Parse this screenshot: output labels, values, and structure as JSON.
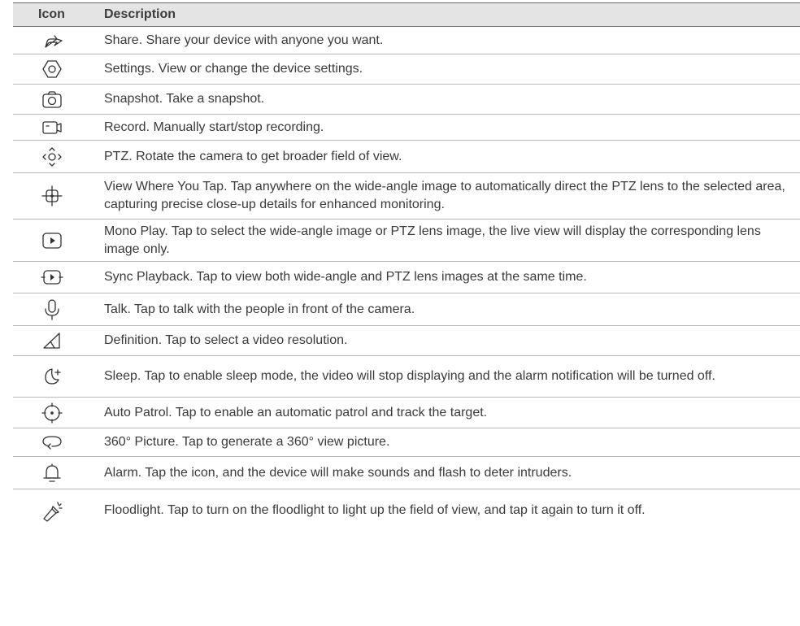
{
  "header": {
    "icon": "Icon",
    "description": "Description"
  },
  "rows": [
    {
      "icon": "share-icon",
      "text": "Share. Share your device with anyone you want."
    },
    {
      "icon": "settings-icon",
      "text": "Settings. View or change the device settings."
    },
    {
      "icon": "camera-icon",
      "text": "Snapshot. Take a snapshot."
    },
    {
      "icon": "record-icon",
      "text": "Record. Manually start/stop recording."
    },
    {
      "icon": "ptz-icon",
      "text": "PTZ. Rotate the camera to get broader field of view."
    },
    {
      "icon": "target-crosshair-icon",
      "text": "View Where You Tap. Tap anywhere on the wide-angle image to automatically direct the PTZ lens to the selected area, capturing precise close-up details for enhanced monitoring."
    },
    {
      "icon": "mono-play-icon",
      "text": "Mono Play. Tap to select the wide-angle image or PTZ lens image, the live view will display the corresponding lens image only."
    },
    {
      "icon": "sync-playback-icon",
      "text": "Sync Playback. Tap to view both wide-angle and PTZ lens images at the same time."
    },
    {
      "icon": "microphone-icon",
      "text": "Talk. Tap to talk with the people in front of the camera."
    },
    {
      "icon": "definition-icon",
      "text": "Definition. Tap to select a video resolution."
    },
    {
      "icon": "sleep-moon-icon",
      "text": "Sleep. Tap to enable sleep mode, the video will stop displaying and the alarm notification will be turned off."
    },
    {
      "icon": "auto-patrol-icon",
      "text": "Auto Patrol. Tap to enable an automatic patrol and track the target."
    },
    {
      "icon": "360-picture-icon",
      "text": "360° Picture. Tap to generate a 360° view picture."
    },
    {
      "icon": "bell-icon",
      "text": "Alarm. Tap the icon, and the device will make sounds and flash to deter intruders."
    },
    {
      "icon": "floodlight-icon",
      "text": "Floodlight. Tap to turn on the floodlight to light up the field of view, and tap it again to turn it off."
    }
  ]
}
